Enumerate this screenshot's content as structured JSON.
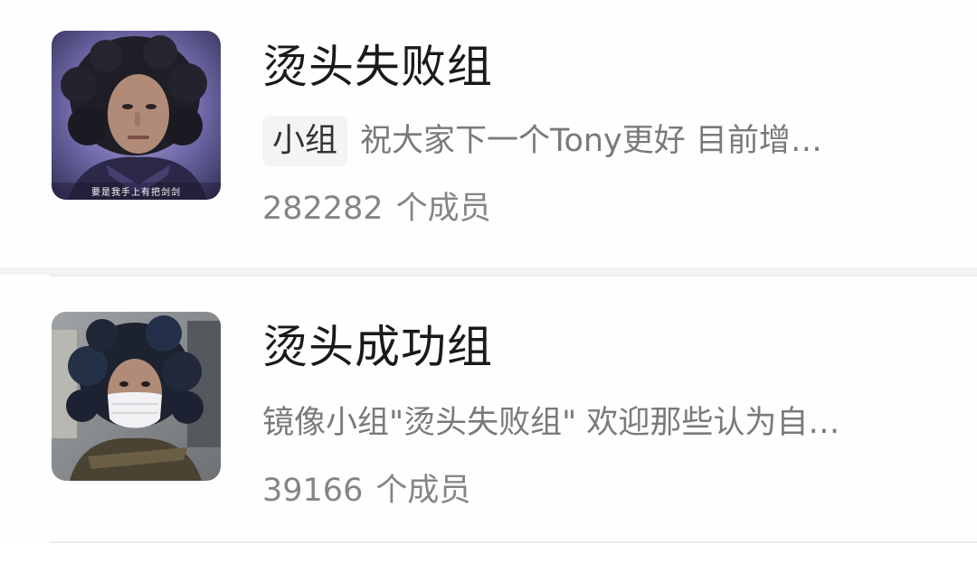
{
  "groups": [
    {
      "title": "烫头失败组",
      "tag": "小组",
      "description": "祝大家下一个Tony更好 目前增…",
      "member_count": "282282",
      "member_suffix": "个成员",
      "avatar_caption": "要是我手上有把剑剑",
      "avatar_colors": {
        "bg": "#3e3b66",
        "glow": "#8f87c9",
        "hair": "#1f1d26"
      }
    },
    {
      "title": "烫头成功组",
      "tag": "",
      "description": "镜像小组\"烫头失败组\" 欢迎那些认为自…",
      "member_count": "39166",
      "member_suffix": "个成员",
      "avatar_caption": "",
      "avatar_colors": {
        "bg": "#8c8f93",
        "hair": "#1d2230",
        "mask": "#f1f1f3"
      }
    }
  ],
  "colors": {
    "title": "#1a1a1a",
    "description": "#7a7a7a",
    "members": "#858585",
    "tag_bg": "#f4f4f4",
    "separator": "#f3f3f3"
  }
}
